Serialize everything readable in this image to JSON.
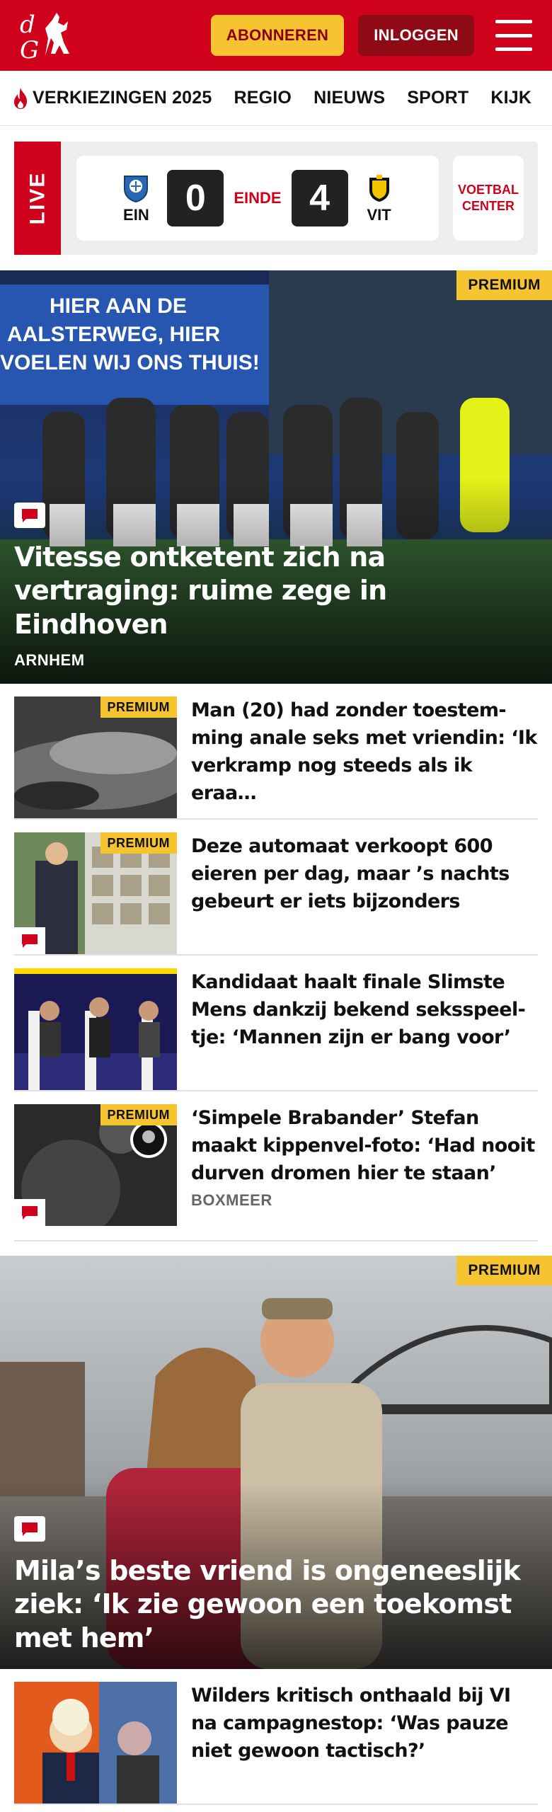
{
  "header": {
    "logo_text": "dG",
    "subscribe_label": "ABONNEREN",
    "login_label": "INLOGGEN",
    "brand_color": "#d0021b",
    "accent_color": "#f6c431"
  },
  "nav": {
    "items": [
      {
        "label": "VERKIEZINGEN 2025",
        "icon": "flame-icon"
      },
      {
        "label": "REGIO"
      },
      {
        "label": "NIEUWS"
      },
      {
        "label": "SPORT"
      },
      {
        "label": "KIJK"
      }
    ]
  },
  "live": {
    "tag": "LIVE",
    "home_team": "EIN",
    "home_score": "0",
    "status": "EINDE",
    "away_team": "VIT",
    "away_score": "4",
    "voetbal_center_line1": "VOETBAL",
    "voetbal_center_line2": "CENTER"
  },
  "hero": {
    "premium": "PREMIUM",
    "title": "Vitesse ontketent zich na vertraging: ruime zege in Eindhoven",
    "location": "ARNHEM",
    "banner_text": "HIER AAN DE AALSTERWEG, HIER VOELEN WIJ ONS THUIS!"
  },
  "articles": [
    {
      "title": "Man (20) had zonder toestem­ming anale seks met vriendin: ‘Ik verkramp nog steeds als ik eraa…",
      "premium": "PREMIUM",
      "location": ""
    },
    {
      "title": "Deze automaat verkoopt 600 eieren per dag, maar ’s nachts gebeurt er iets bijzonders",
      "premium": "PREMIUM",
      "location": ""
    },
    {
      "title": "Kandidaat haalt finale Slimste Mens dankzij bekend seksspeel­tje: ‘Mannen zijn er bang voor’",
      "premium": "",
      "location": ""
    },
    {
      "title": "‘Simpele Brabander’ Stefan maakt kippenvel-foto: ‘Had nooit durven dromen hier te staan’",
      "premium": "PREMIUM",
      "location": "BOXMEER"
    }
  ],
  "hero2": {
    "premium": "PREMIUM",
    "title": "Mila’s beste vriend is ongeneeslijk ziek: ‘Ik zie gewoon een toekomst met hem’"
  },
  "articles2": [
    {
      "title": "Wilders kritisch onthaald bij VI na campagnestop: ‘Was pauze niet gewoon tactisch?’",
      "premium": "",
      "location": ""
    }
  ]
}
